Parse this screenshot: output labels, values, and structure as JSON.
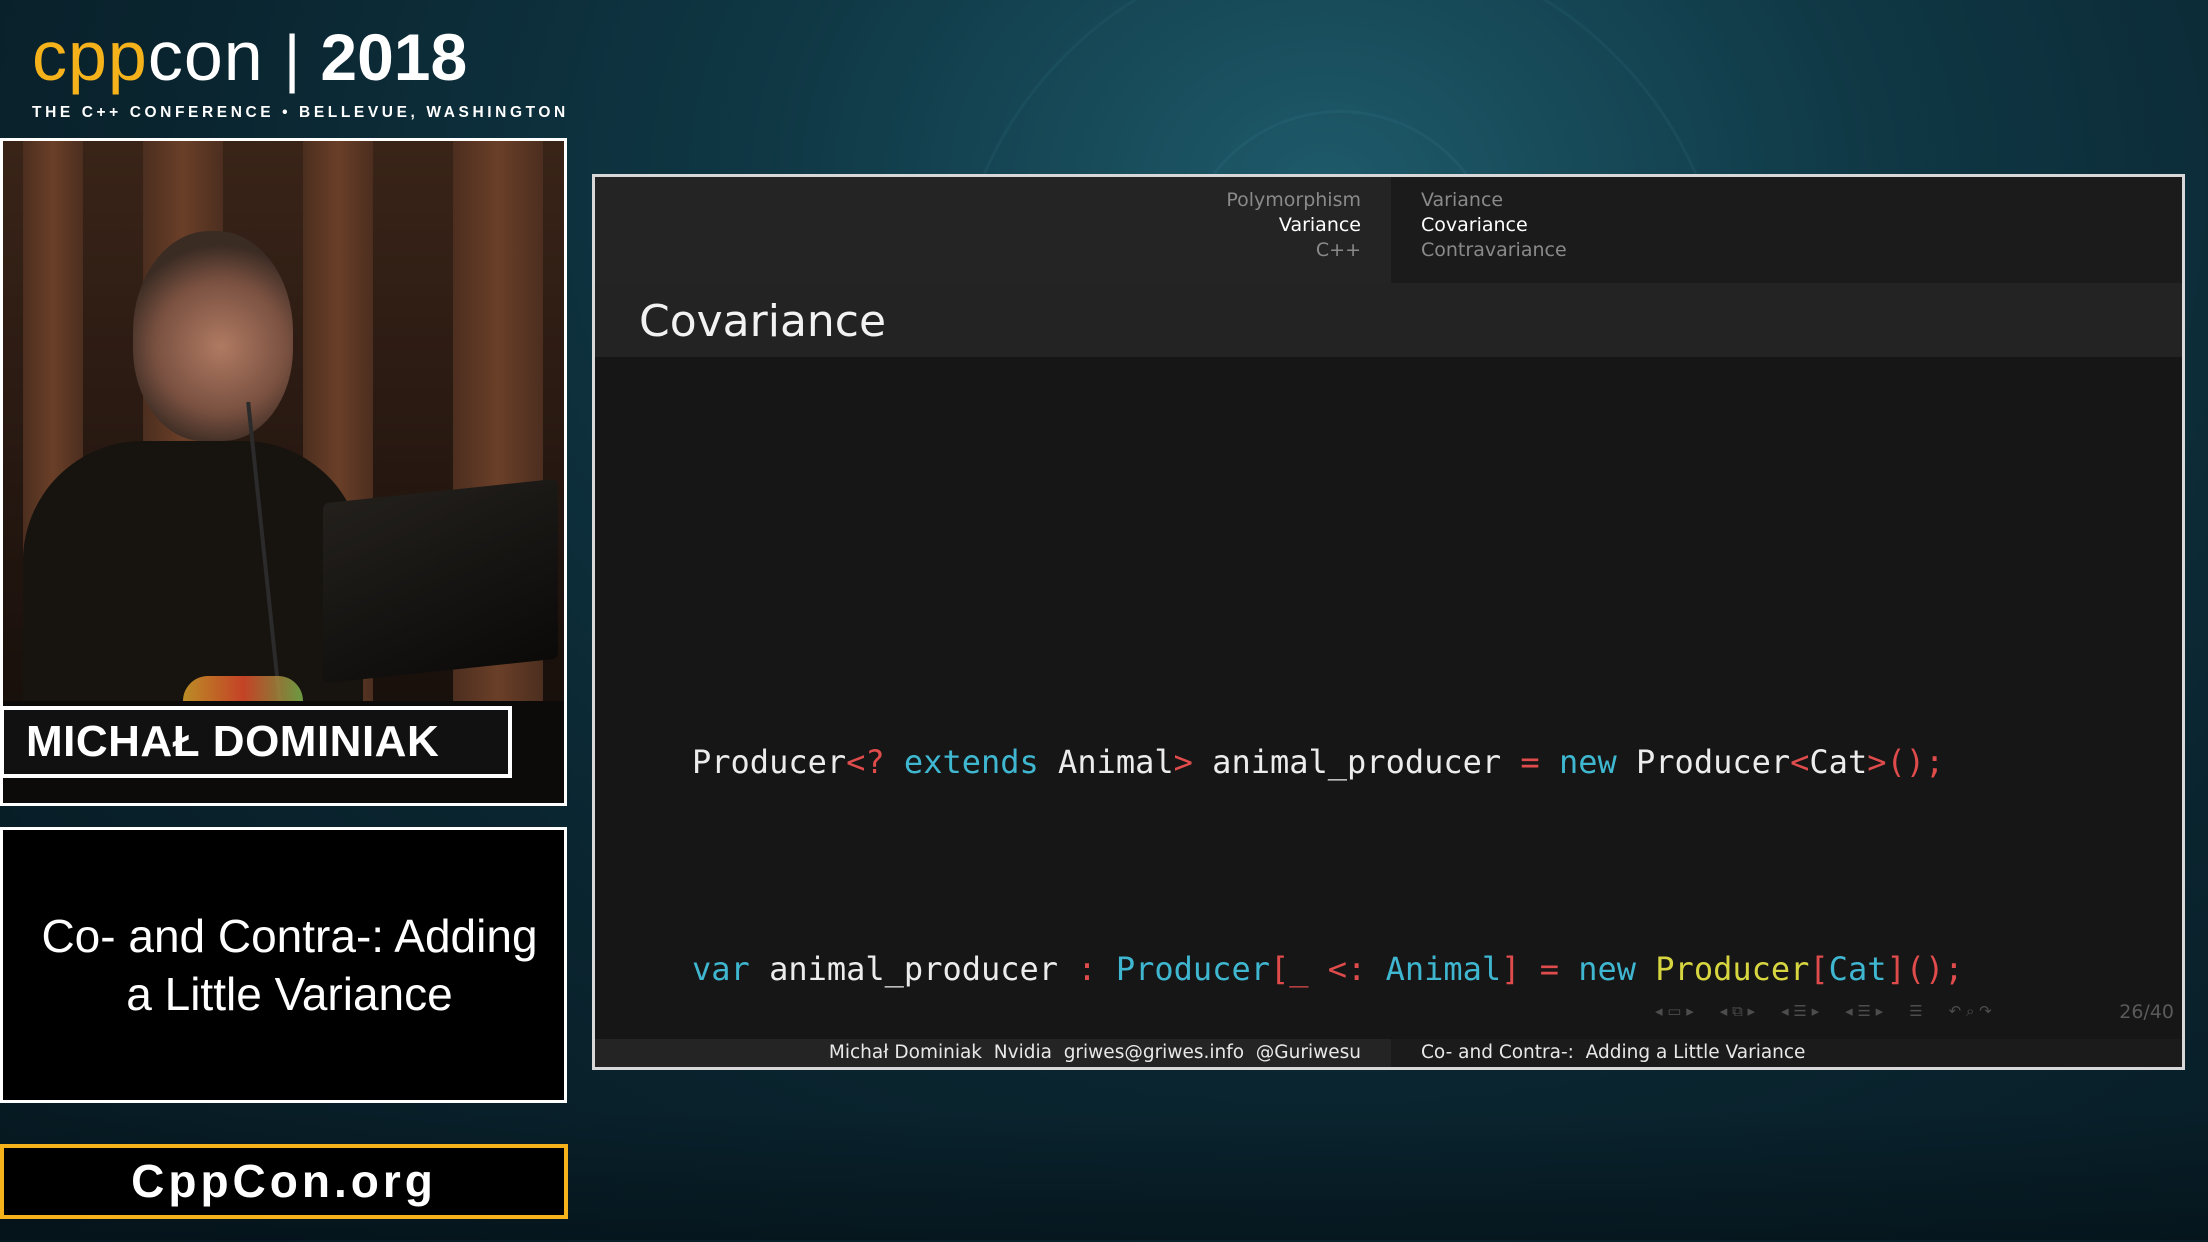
{
  "branding": {
    "cpp": "cpp",
    "con": "con",
    "separator": "|",
    "year": "2018",
    "tagline": "THE C++ CONFERENCE • BELLEVUE, WASHINGTON"
  },
  "speaker": {
    "name": "MICHAŁ DOMINIAK"
  },
  "talk": {
    "title": "Co- and Contra-: Adding a Little Variance"
  },
  "site": {
    "label": "CppCon.org"
  },
  "slide": {
    "nav_sections": [
      "Polymorphism",
      "Variance",
      "C++"
    ],
    "active_section": "Variance",
    "nav_subsections": [
      "Variance",
      "Covariance",
      "Contravariance"
    ],
    "active_subsection": "Covariance",
    "frame_title": "Covariance",
    "code_line1": [
      {
        "t": "Producer",
        "c": "white"
      },
      {
        "t": "<?",
        "c": "red"
      },
      {
        "t": " extends",
        "c": "cyan"
      },
      {
        "t": " Animal",
        "c": "white"
      },
      {
        "t": ">",
        "c": "red"
      },
      {
        "t": " animal_producer ",
        "c": "white"
      },
      {
        "t": "=",
        "c": "red"
      },
      {
        "t": " new",
        "c": "cyan"
      },
      {
        "t": " Producer",
        "c": "white"
      },
      {
        "t": "<",
        "c": "red"
      },
      {
        "t": "Cat",
        "c": "white"
      },
      {
        "t": ">();",
        "c": "red"
      }
    ],
    "code_line2": [
      {
        "t": "var",
        "c": "cyan"
      },
      {
        "t": " animal_producer ",
        "c": "white"
      },
      {
        "t": ":",
        "c": "red"
      },
      {
        "t": " Producer",
        "c": "cyan"
      },
      {
        "t": "[_",
        "c": "red"
      },
      {
        "t": " <:",
        "c": "red"
      },
      {
        "t": " Animal",
        "c": "cyan"
      },
      {
        "t": "]",
        "c": "red"
      },
      {
        "t": " =",
        "c": "red"
      },
      {
        "t": " new",
        "c": "cyan"
      },
      {
        "t": " Producer",
        "c": "yellow"
      },
      {
        "t": "[",
        "c": "red"
      },
      {
        "t": "Cat",
        "c": "cyan"
      },
      {
        "t": "]();",
        "c": "red"
      }
    ],
    "page_number": "26/40",
    "footer_left": "Michał Dominiak  Nvidia  griwes@griwes.info  @Guriwesu",
    "footer_right": "Co- and Contra-:  Adding a Little Variance"
  },
  "colors": {
    "cpp_orange": "#f6b21a",
    "code_red": "#e04c4c",
    "code_cyan": "#3fb7d0",
    "code_yellow": "#d7d641"
  },
  "icons": {
    "beamer_nav": [
      "prev-frame-icon",
      "frame-icon",
      "next-frame-icon",
      "prev-subsection-icon",
      "subsection-icon",
      "next-subsection-icon",
      "prev-section-icon",
      "section-icon",
      "next-section-icon",
      "document-icon",
      "back-icon",
      "search-icon",
      "forward-icon"
    ]
  }
}
